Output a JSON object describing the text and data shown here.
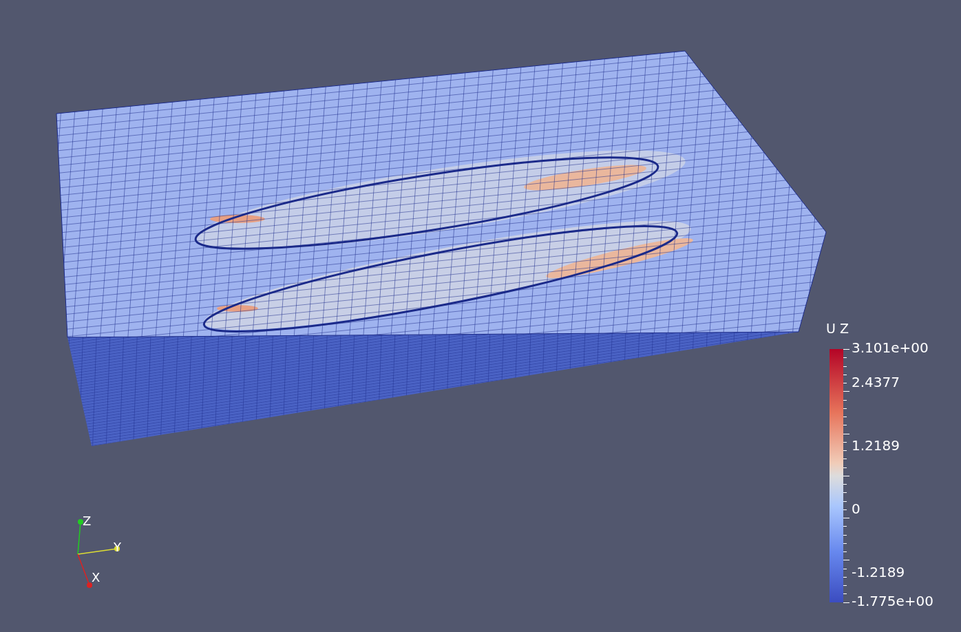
{
  "legend": {
    "title": "U Z",
    "labels": [
      "3.101e+00",
      "2.4377",
      "1.2189",
      "0",
      "-1.2189",
      "-1.775e+00"
    ]
  },
  "axes": [
    {
      "kind": "z",
      "text": "Z"
    },
    {
      "kind": "y",
      "text": "Y"
    },
    {
      "kind": "x",
      "text": "X"
    }
  ]
}
